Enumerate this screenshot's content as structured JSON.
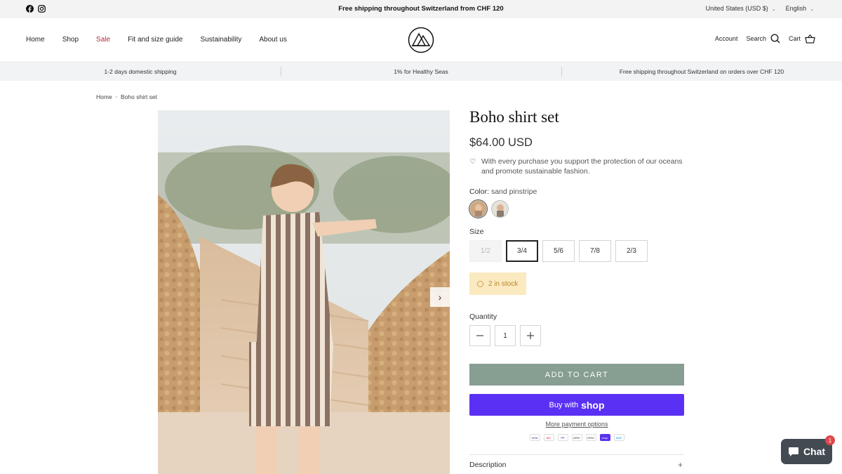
{
  "topbar": {
    "announcement": "Free shipping throughout Switzerland from CHF 120",
    "currency": "United States (USD $)",
    "language": "English",
    "social_icons": [
      "facebook-icon",
      "instagram-icon"
    ]
  },
  "header": {
    "nav": [
      "Home",
      "Shop",
      "Sale",
      "Fit and size guide",
      "Sustainability",
      "About us"
    ],
    "account_label": "Account",
    "search_label": "Search",
    "cart_label": "Cart"
  },
  "benefits": [
    "1-2 days domestic shipping",
    "1% for Healthy Seas",
    "Free shipping throughout Switzerland on orders over CHF 120"
  ],
  "breadcrumb": {
    "home": "Home",
    "current": "Boho shirt set"
  },
  "product": {
    "title": "Boho shirt set",
    "price": "$64.00 USD",
    "support_text": "With every purchase you support the protection of our oceans and promote sustainable fashion.",
    "color_label": "Color:",
    "color_value": "sand pinstripe",
    "size_label": "Size",
    "sizes": [
      "1/2",
      "3/4",
      "5/6",
      "7/8",
      "2/3"
    ],
    "selected_size": "3/4",
    "stock_text": "2 in stock",
    "quantity_label": "Quantity",
    "quantity": "1",
    "add_to_cart": "ADD TO CART",
    "buy_with": "Buy with",
    "shop_brand": "shop",
    "more_payment": "More payment options",
    "description_label": "Description"
  },
  "payment_icons": [
    "VISA",
    "MC",
    "PP",
    "APAY",
    "GPAY",
    "shop",
    "MAE"
  ],
  "chat": {
    "label": "Chat",
    "badge": "1"
  },
  "colors": {
    "sale": "#b5283b",
    "add_to_cart_bg": "#879e92",
    "shop_pay_bg": "#5a31f4",
    "stock_bg": "#fbe9c0",
    "chat_bg": "#434a52"
  }
}
